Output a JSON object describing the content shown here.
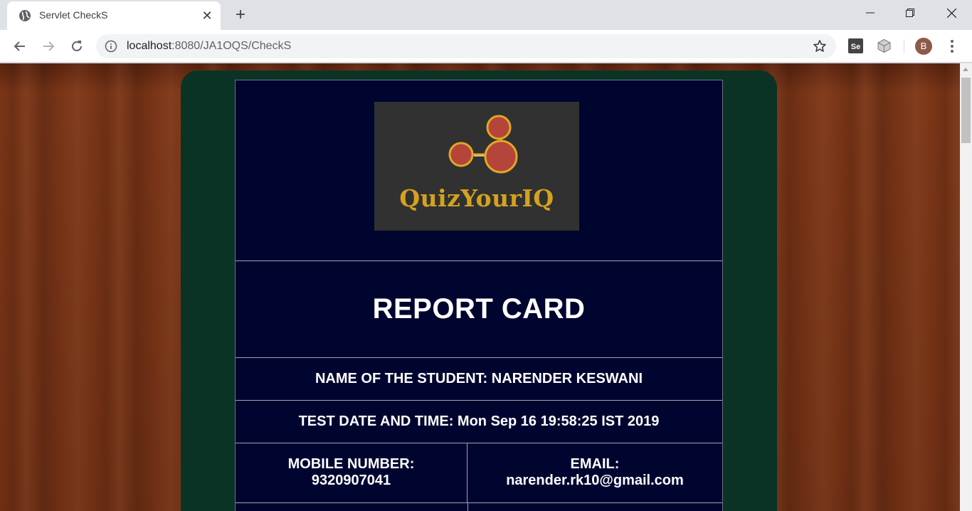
{
  "browser": {
    "tab_title": "Servlet CheckS",
    "url_host": "localhost",
    "url_path": ":8080/JA1OQS/CheckS",
    "avatar_letter": "B",
    "extension_label": "Se"
  },
  "page": {
    "logo_text": "QuizYourIQ",
    "report_title": "REPORT CARD",
    "student_name": "NAME OF THE STUDENT: NARENDER KESWANI",
    "test_datetime": "TEST DATE AND TIME: Mon Sep 16 19:58:25 IST 2019",
    "mobile_label": "MOBILE NUMBER:",
    "mobile_value": "9320907041",
    "email_label": "EMAIL:",
    "email_value": "narender.rk10@gmail.com"
  },
  "colors": {
    "panel": "#0b3325",
    "card": "#000530",
    "logo_gold": "#d4a21f",
    "logo_red": "#b5453a"
  }
}
